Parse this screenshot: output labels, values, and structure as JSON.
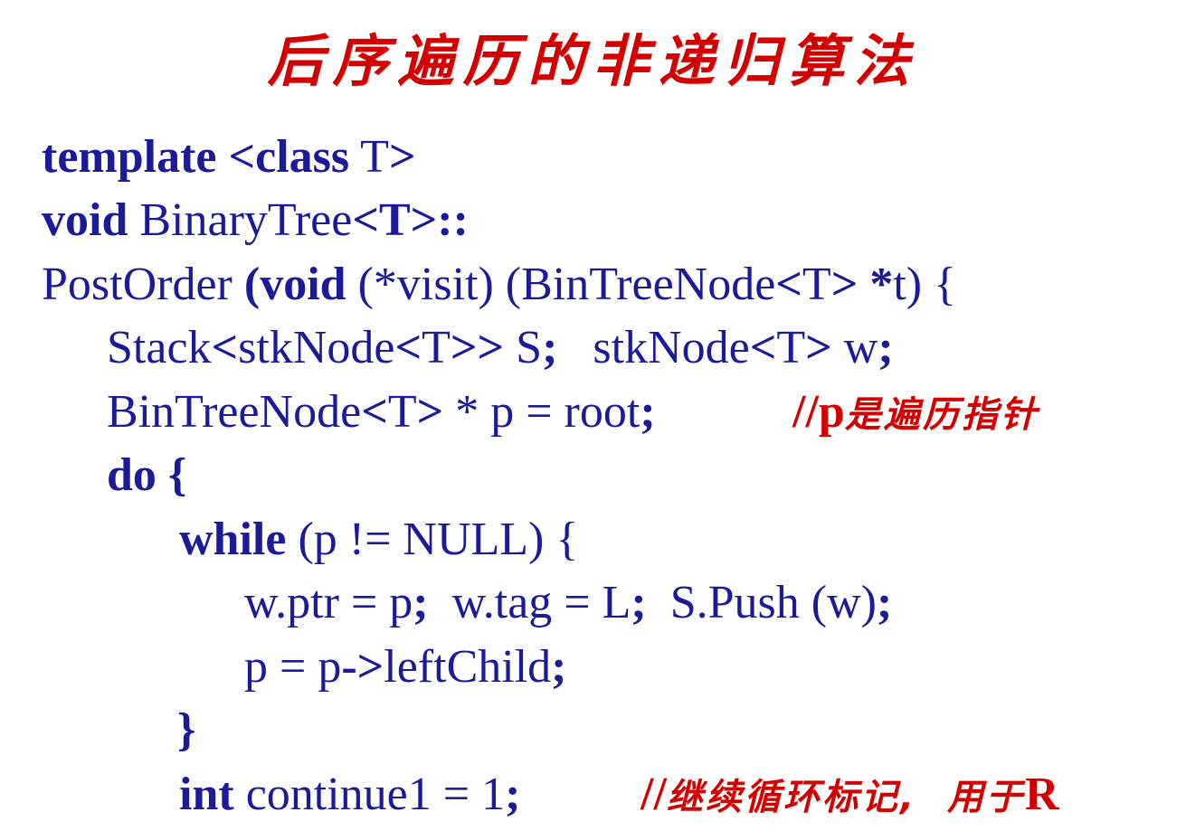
{
  "title": "后序遍历的非递归算法",
  "code": {
    "l1_kw": "template <class",
    "l1_rest": " T",
    "l1_end": ">",
    "l2_kw": "void",
    "l2_rest": " BinaryTree",
    "l2_sym": "<T>::",
    "l3_a": "PostOrder ",
    "l3_b": "(",
    "l3_kw": "void",
    "l3_c": " (*visit) (BinTreeNode",
    "l3_d": "<",
    "l3_e": "T",
    "l3_f": "> *",
    "l3_g": "t) {",
    "l4_a": "Stack",
    "l4_b": "<",
    "l4_c": "stkNode",
    "l4_d": "<",
    "l4_e": "T",
    "l4_f": ">>",
    "l4_g": " S",
    "l4_h": ";",
    "l4_i": "   stkNode",
    "l4_j": "<",
    "l4_k": "T",
    "l4_l": ">",
    "l4_m": " w",
    "l4_n": ";",
    "l5_a": "BinTreeNode",
    "l5_b": "<",
    "l5_c": "T",
    "l5_d": ">",
    "l5_e": " * p = root",
    "l5_f": ";",
    "l5_comment_slash": "//p",
    "l5_comment_cjk": "是遍历指针",
    "l6_kw": "do",
    "l6_rest": " {",
    "l7_kw": "while",
    "l7_rest": " (p != NULL) {",
    "l8_a": "w.ptr = p",
    "l8_b": ";",
    "l8_c": "  w.tag = L",
    "l8_d": ";",
    "l8_e": "  S.Push (w)",
    "l8_f": ";",
    "l9_a": "p = p",
    "l9_b": "->",
    "l9_c": "leftChild",
    "l9_d": ";",
    "l10": "}",
    "l11_kw": "int",
    "l11_rest": " continue1 = 1",
    "l11_semi": ";",
    "l11_comment_slash": "//",
    "l11_comment_cjk": "继续循环标记,  用于",
    "l11_comment_r": "R"
  },
  "colors": {
    "title": "#d40000",
    "code": "#1a1a9a",
    "comment": "#d40000",
    "background": "#ffffff"
  }
}
